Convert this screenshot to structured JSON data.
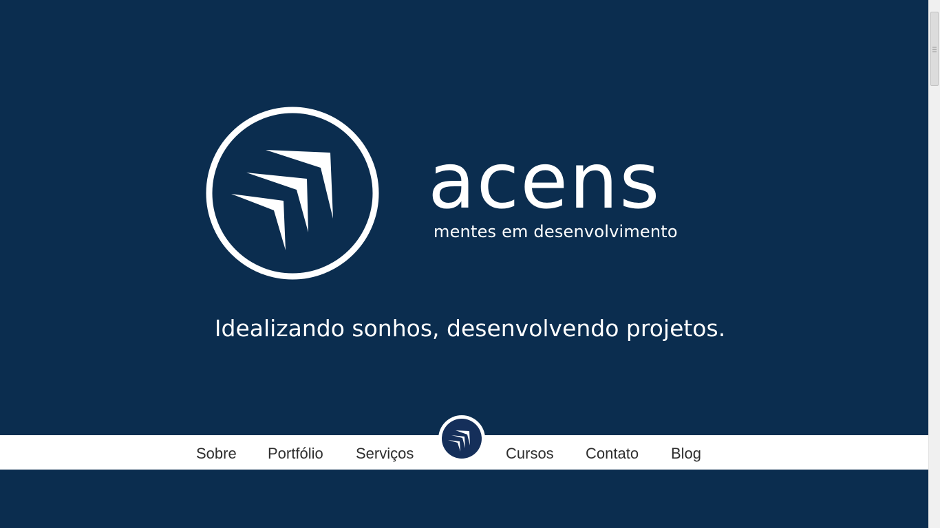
{
  "brand": {
    "name": "acens",
    "slogan": "mentes em desenvolvimento",
    "logo_icon": "arrows-in-circle-icon"
  },
  "hero": {
    "headline": "Idealizando sonhos, desenvolvendo projetos."
  },
  "nav": {
    "items": [
      {
        "label": "Sobre"
      },
      {
        "label": "Portfólio"
      },
      {
        "label": "Serviços"
      },
      {
        "label": "Cursos"
      },
      {
        "label": "Contato"
      },
      {
        "label": "Blog"
      }
    ],
    "center_logo_icon": "acens-logo-icon"
  },
  "colors": {
    "background": "#0b2d4f",
    "nav_background": "#ffffff",
    "nav_text": "#2e2e2e",
    "logo_badge": "#152f5a",
    "text_light": "#ffffff"
  }
}
